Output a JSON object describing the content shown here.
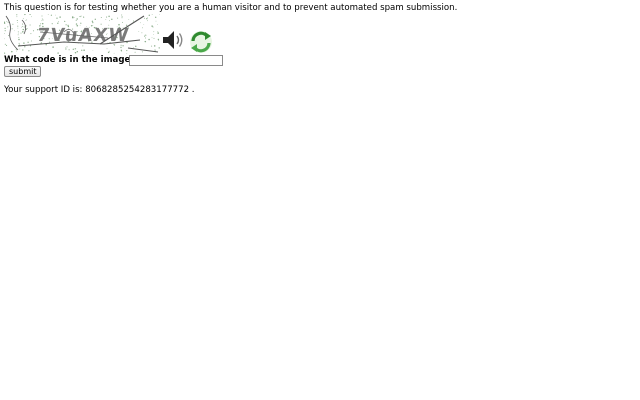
{
  "intro_text": "This question is for testing whether you are a human visitor and to prevent automated spam submission.",
  "captcha": {
    "image_text": "7VuAXW",
    "audio_icon": "speaker-icon",
    "refresh_icon": "refresh-icon",
    "refresh_color": "#3a9a3a"
  },
  "question": {
    "label": "What code is in the image?",
    "input_value": ""
  },
  "submit_label": "submit",
  "support": {
    "prefix": "Your support ID is: ",
    "id": "8068285254283177772",
    "suffix": " ."
  }
}
